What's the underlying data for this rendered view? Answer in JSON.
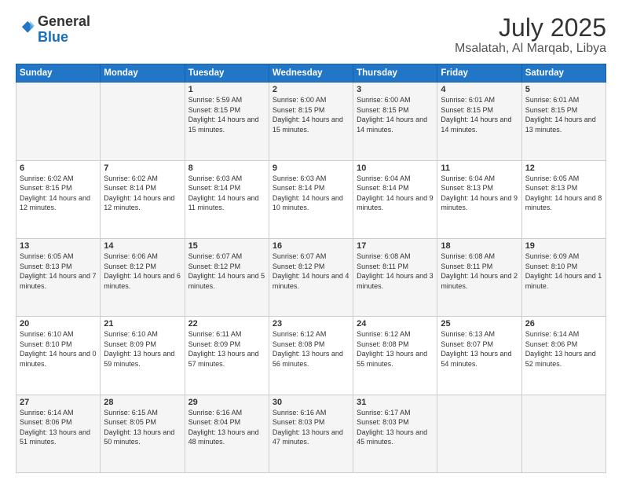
{
  "header": {
    "logo_line1": "General",
    "logo_line2": "Blue",
    "month": "July 2025",
    "location": "Msalatah, Al Marqab, Libya"
  },
  "weekdays": [
    "Sunday",
    "Monday",
    "Tuesday",
    "Wednesday",
    "Thursday",
    "Friday",
    "Saturday"
  ],
  "weeks": [
    [
      {
        "day": "",
        "info": ""
      },
      {
        "day": "",
        "info": ""
      },
      {
        "day": "1",
        "info": "Sunrise: 5:59 AM\nSunset: 8:15 PM\nDaylight: 14 hours and 15 minutes."
      },
      {
        "day": "2",
        "info": "Sunrise: 6:00 AM\nSunset: 8:15 PM\nDaylight: 14 hours and 15 minutes."
      },
      {
        "day": "3",
        "info": "Sunrise: 6:00 AM\nSunset: 8:15 PM\nDaylight: 14 hours and 14 minutes."
      },
      {
        "day": "4",
        "info": "Sunrise: 6:01 AM\nSunset: 8:15 PM\nDaylight: 14 hours and 14 minutes."
      },
      {
        "day": "5",
        "info": "Sunrise: 6:01 AM\nSunset: 8:15 PM\nDaylight: 14 hours and 13 minutes."
      }
    ],
    [
      {
        "day": "6",
        "info": "Sunrise: 6:02 AM\nSunset: 8:15 PM\nDaylight: 14 hours and 12 minutes."
      },
      {
        "day": "7",
        "info": "Sunrise: 6:02 AM\nSunset: 8:14 PM\nDaylight: 14 hours and 12 minutes."
      },
      {
        "day": "8",
        "info": "Sunrise: 6:03 AM\nSunset: 8:14 PM\nDaylight: 14 hours and 11 minutes."
      },
      {
        "day": "9",
        "info": "Sunrise: 6:03 AM\nSunset: 8:14 PM\nDaylight: 14 hours and 10 minutes."
      },
      {
        "day": "10",
        "info": "Sunrise: 6:04 AM\nSunset: 8:14 PM\nDaylight: 14 hours and 9 minutes."
      },
      {
        "day": "11",
        "info": "Sunrise: 6:04 AM\nSunset: 8:13 PM\nDaylight: 14 hours and 9 minutes."
      },
      {
        "day": "12",
        "info": "Sunrise: 6:05 AM\nSunset: 8:13 PM\nDaylight: 14 hours and 8 minutes."
      }
    ],
    [
      {
        "day": "13",
        "info": "Sunrise: 6:05 AM\nSunset: 8:13 PM\nDaylight: 14 hours and 7 minutes."
      },
      {
        "day": "14",
        "info": "Sunrise: 6:06 AM\nSunset: 8:12 PM\nDaylight: 14 hours and 6 minutes."
      },
      {
        "day": "15",
        "info": "Sunrise: 6:07 AM\nSunset: 8:12 PM\nDaylight: 14 hours and 5 minutes."
      },
      {
        "day": "16",
        "info": "Sunrise: 6:07 AM\nSunset: 8:12 PM\nDaylight: 14 hours and 4 minutes."
      },
      {
        "day": "17",
        "info": "Sunrise: 6:08 AM\nSunset: 8:11 PM\nDaylight: 14 hours and 3 minutes."
      },
      {
        "day": "18",
        "info": "Sunrise: 6:08 AM\nSunset: 8:11 PM\nDaylight: 14 hours and 2 minutes."
      },
      {
        "day": "19",
        "info": "Sunrise: 6:09 AM\nSunset: 8:10 PM\nDaylight: 14 hours and 1 minute."
      }
    ],
    [
      {
        "day": "20",
        "info": "Sunrise: 6:10 AM\nSunset: 8:10 PM\nDaylight: 14 hours and 0 minutes."
      },
      {
        "day": "21",
        "info": "Sunrise: 6:10 AM\nSunset: 8:09 PM\nDaylight: 13 hours and 59 minutes."
      },
      {
        "day": "22",
        "info": "Sunrise: 6:11 AM\nSunset: 8:09 PM\nDaylight: 13 hours and 57 minutes."
      },
      {
        "day": "23",
        "info": "Sunrise: 6:12 AM\nSunset: 8:08 PM\nDaylight: 13 hours and 56 minutes."
      },
      {
        "day": "24",
        "info": "Sunrise: 6:12 AM\nSunset: 8:08 PM\nDaylight: 13 hours and 55 minutes."
      },
      {
        "day": "25",
        "info": "Sunrise: 6:13 AM\nSunset: 8:07 PM\nDaylight: 13 hours and 54 minutes."
      },
      {
        "day": "26",
        "info": "Sunrise: 6:14 AM\nSunset: 8:06 PM\nDaylight: 13 hours and 52 minutes."
      }
    ],
    [
      {
        "day": "27",
        "info": "Sunrise: 6:14 AM\nSunset: 8:06 PM\nDaylight: 13 hours and 51 minutes."
      },
      {
        "day": "28",
        "info": "Sunrise: 6:15 AM\nSunset: 8:05 PM\nDaylight: 13 hours and 50 minutes."
      },
      {
        "day": "29",
        "info": "Sunrise: 6:16 AM\nSunset: 8:04 PM\nDaylight: 13 hours and 48 minutes."
      },
      {
        "day": "30",
        "info": "Sunrise: 6:16 AM\nSunset: 8:03 PM\nDaylight: 13 hours and 47 minutes."
      },
      {
        "day": "31",
        "info": "Sunrise: 6:17 AM\nSunset: 8:03 PM\nDaylight: 13 hours and 45 minutes."
      },
      {
        "day": "",
        "info": ""
      },
      {
        "day": "",
        "info": ""
      }
    ]
  ]
}
